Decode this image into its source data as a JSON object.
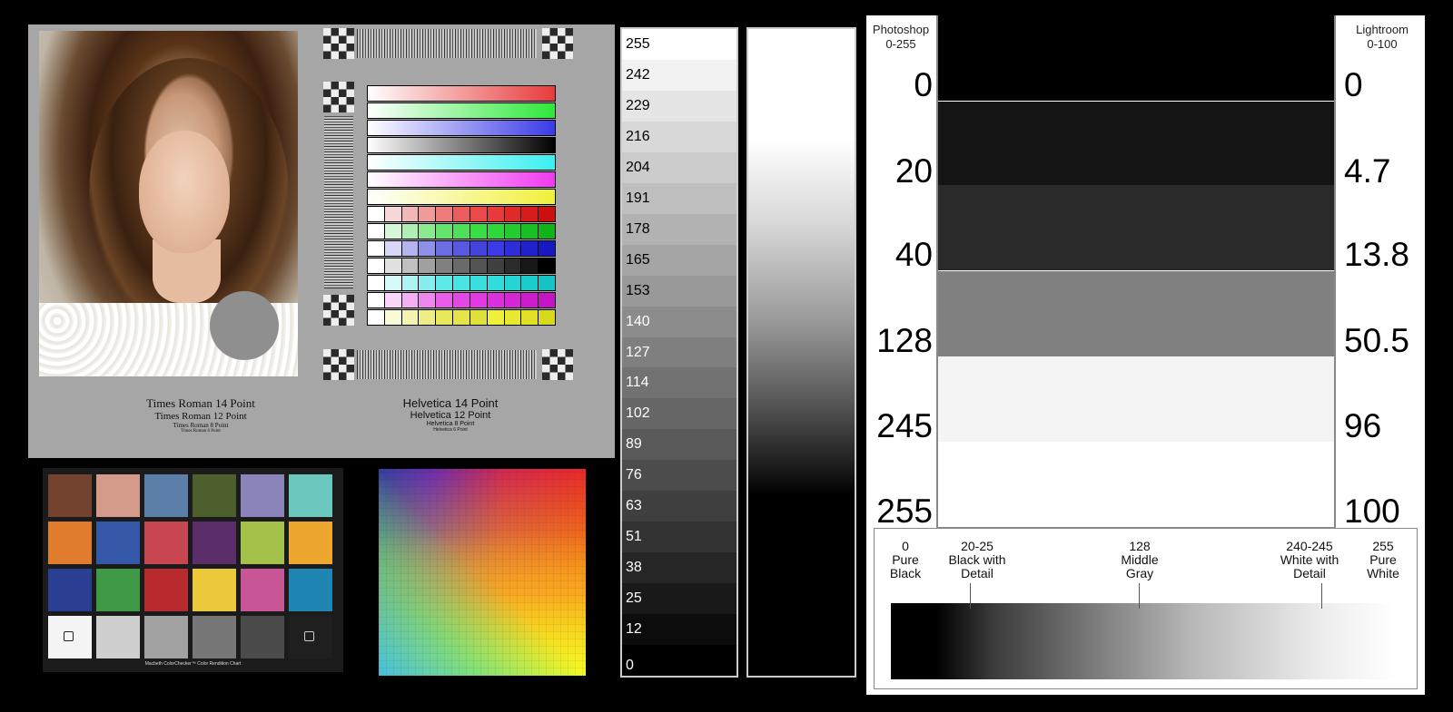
{
  "target": {
    "font_samples_serif": [
      "Times Roman 14 Point",
      "Times Roman 12 Point",
      "Times Roman 8 Point",
      "Times Roman 6 Point"
    ],
    "font_samples_sans": [
      "Helvetica 14 Point",
      "Helvetica 12 Point",
      "Helvetica 8 Point",
      "Helvetica 6 Point"
    ],
    "ramps": [
      [
        "#ffffff",
        "#e83a3a"
      ],
      [
        "#ffffff",
        "#2ee83a"
      ],
      [
        "#ffffff",
        "#3a3ae8"
      ],
      [
        "#ffffff",
        "#000000"
      ],
      [
        "#ffffff",
        "#3af0f0"
      ],
      [
        "#ffffff",
        "#f03af0"
      ],
      [
        "#ffffff",
        "#f0f03a"
      ]
    ],
    "patch_rows": [
      [
        "#ffffff",
        "#f6d6d6",
        "#f2b8b8",
        "#f09a9a",
        "#ee7c7c",
        "#ec5e5e",
        "#ea4a4a",
        "#e83a3a",
        "#e02a2a",
        "#d61c1c",
        "#cc1010"
      ],
      [
        "#ffffff",
        "#d6f6d8",
        "#b0f0b4",
        "#8aea90",
        "#64e46c",
        "#4ee058",
        "#3adc44",
        "#2ed83a",
        "#22cc2e",
        "#18c024",
        "#10b41a"
      ],
      [
        "#ffffff",
        "#d8d8f6",
        "#b4b4f0",
        "#9090ea",
        "#6c6ce4",
        "#5858e0",
        "#4444dc",
        "#3a3ae8",
        "#2e2ed8",
        "#2222cc",
        "#1818c0"
      ],
      [
        "#ffffff",
        "#e0e0e0",
        "#c0c0c0",
        "#a0a0a0",
        "#808080",
        "#6a6a6a",
        "#545454",
        "#404040",
        "#2c2c2c",
        "#181818",
        "#000000"
      ],
      [
        "#ffffff",
        "#d6fafa",
        "#aef4f4",
        "#86eeee",
        "#5ee8e8",
        "#48e4e4",
        "#3ae0e0",
        "#30dcdc",
        "#26d4d4",
        "#1ccccc",
        "#14c4c4"
      ],
      [
        "#ffffff",
        "#fad6fa",
        "#f4aef4",
        "#ee86ee",
        "#e85ee8",
        "#e448e4",
        "#e03ae0",
        "#dc30dc",
        "#d426d4",
        "#cc1ccc",
        "#c414c4"
      ],
      [
        "#ffffff",
        "#fafad6",
        "#f4f4ae",
        "#eeee86",
        "#e8e85e",
        "#e4e448",
        "#e0e03a",
        "#f0f03a",
        "#e8e830",
        "#e0e026",
        "#d8d81c"
      ]
    ]
  },
  "colorchecker": {
    "label": "Macbeth ColorChecker™ Color Rendition Chart",
    "swatches": [
      "#73432f",
      "#d49a8a",
      "#5b7fa8",
      "#4e5f2e",
      "#8b84bb",
      "#6cc7bf",
      "#e07c2c",
      "#3558a8",
      "#c74650",
      "#5b2e6a",
      "#a4c24a",
      "#eda72e",
      "#2a3f94",
      "#3f9a48",
      "#b82a2e",
      "#ebc93a",
      "#c85596",
      "#1f86b4",
      "#f4f4f4",
      "#cfcfcf",
      "#a2a2a2",
      "#777777",
      "#4b4b4b",
      "#1f1f1f"
    ]
  },
  "stepwedge": {
    "values": [
      "255",
      "242",
      "229",
      "216",
      "204",
      "191",
      "178",
      "165",
      "153",
      "140",
      "127",
      "114",
      "102",
      "89",
      "76",
      "63",
      "51",
      "38",
      "25",
      "12",
      "0"
    ]
  },
  "valuechart": {
    "photoshop_header": [
      "Photoshop",
      "0-255"
    ],
    "lightroom_header": [
      "Lightroom",
      "0-100"
    ],
    "photoshop_values": [
      "0",
      "20",
      "40",
      "128",
      "245",
      "255"
    ],
    "lightroom_values": [
      "0",
      "4.7",
      "13.8",
      "50.5",
      "96",
      "100"
    ],
    "band_colors": [
      "#000000",
      "#141414",
      "#2a2a2a",
      "#808080",
      "#f4f4f4",
      "#ffffff"
    ],
    "zones": [
      {
        "value": "0",
        "lines": [
          "Pure",
          "Black"
        ]
      },
      {
        "value": "20-25",
        "lines": [
          "Black with",
          "Detail"
        ]
      },
      {
        "value": "128",
        "lines": [
          "Middle",
          "Gray"
        ]
      },
      {
        "value": "240-245",
        "lines": [
          "White with",
          "Detail"
        ]
      },
      {
        "value": "255",
        "lines": [
          "Pure",
          "White"
        ]
      }
    ]
  }
}
